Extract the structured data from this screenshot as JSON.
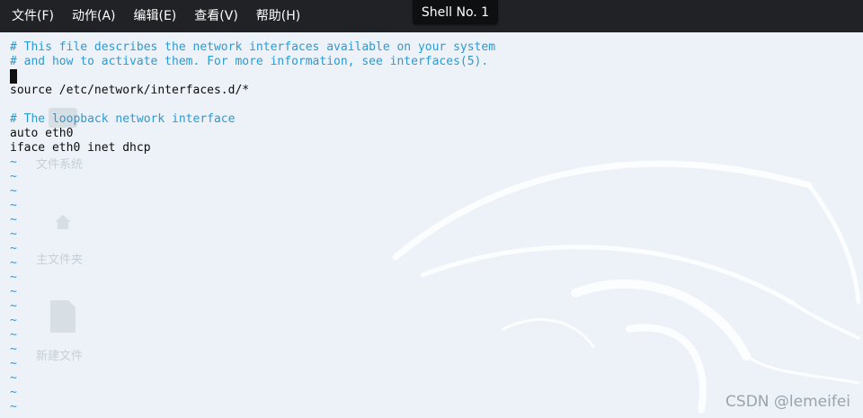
{
  "menu": [
    "文件(F)",
    "动作(A)",
    "编辑(E)",
    "查看(V)",
    "帮助(H)"
  ],
  "tab": {
    "title": "Shell No. 1"
  },
  "editor": {
    "lines": [
      {
        "text": "# This file describes the network interfaces available on your system",
        "kind": "comment"
      },
      {
        "text": "# and how to activate them. For more information, see interfaces(5).",
        "kind": "comment"
      },
      {
        "text": "",
        "kind": "cursor"
      },
      {
        "text": "source /etc/network/interfaces.d/*",
        "kind": "code"
      },
      {
        "text": "",
        "kind": "blank"
      },
      {
        "text": "# The loopback network interface",
        "kind": "comment"
      },
      {
        "text": "auto eth0",
        "kind": "code"
      },
      {
        "text": "iface eth0 inet dhcp",
        "kind": "code"
      },
      {
        "text": "~",
        "kind": "tilde"
      },
      {
        "text": "~",
        "kind": "tilde"
      },
      {
        "text": "~",
        "kind": "tilde"
      },
      {
        "text": "~",
        "kind": "tilde"
      },
      {
        "text": "~",
        "kind": "tilde"
      },
      {
        "text": "~",
        "kind": "tilde"
      },
      {
        "text": "~",
        "kind": "tilde"
      },
      {
        "text": "~",
        "kind": "tilde"
      },
      {
        "text": "~",
        "kind": "tilde"
      },
      {
        "text": "~",
        "kind": "tilde"
      },
      {
        "text": "~",
        "kind": "tilde"
      },
      {
        "text": "~",
        "kind": "tilde"
      },
      {
        "text": "~",
        "kind": "tilde"
      },
      {
        "text": "~",
        "kind": "tilde"
      },
      {
        "text": "~",
        "kind": "tilde"
      },
      {
        "text": "~",
        "kind": "tilde"
      },
      {
        "text": "~",
        "kind": "tilde"
      },
      {
        "text": "~",
        "kind": "tilde"
      }
    ]
  },
  "desktop_icons": [
    {
      "label": "文件系统",
      "icon": "drive-icon"
    },
    {
      "label": "主文件夹",
      "icon": "home-icon"
    },
    {
      "label": "新建文件",
      "icon": "file-icon"
    }
  ],
  "watermark": "CSDN @lemeifei",
  "colors": {
    "menubar": "#202226",
    "comment": "#2a9bd6",
    "background": "#ecf2f7"
  }
}
